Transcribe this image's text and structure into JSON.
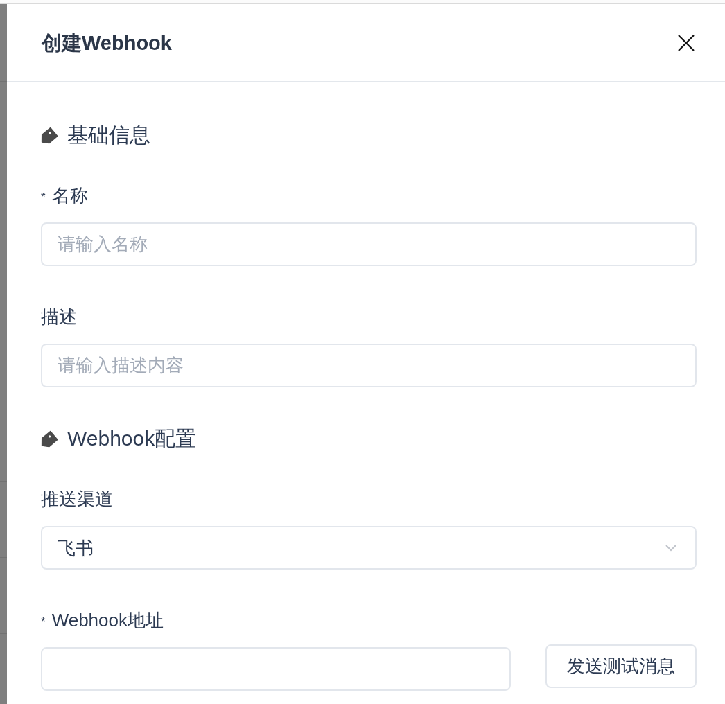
{
  "drawer": {
    "title": "创建Webhook"
  },
  "sections": [
    {
      "heading": "基础信息",
      "fields": [
        {
          "kind": "input",
          "label": "名称",
          "required_mark": "*",
          "placeholder": "请输入名称"
        },
        {
          "kind": "input",
          "label": "描述",
          "placeholder": "请输入描述内容"
        }
      ]
    },
    {
      "heading": "Webhook配置",
      "fields": [
        {
          "kind": "select",
          "label": "推送渠道",
          "value": "飞书"
        },
        {
          "kind": "input_with_button",
          "label": "Webhook地址",
          "required_mark": "*",
          "button": "发送测试消息"
        }
      ]
    }
  ]
}
